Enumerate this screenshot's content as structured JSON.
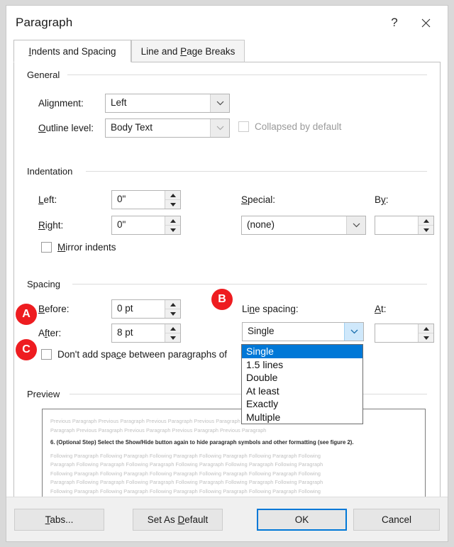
{
  "window": {
    "title": "Paragraph",
    "help_icon": "question-mark-icon",
    "close_icon": "close-icon"
  },
  "tabs": [
    {
      "label": "Indents and Spacing",
      "active": true
    },
    {
      "label": "Line and Page Breaks",
      "active": false
    }
  ],
  "general": {
    "group_label": "General",
    "alignment_label": "Alignment:",
    "alignment_value": "Left",
    "outline_label": "Outline level:",
    "outline_value": "Body Text",
    "collapsed_label": "Collapsed by default",
    "collapsed_checked": false,
    "collapsed_disabled": true
  },
  "indentation": {
    "group_label": "Indentation",
    "left_label": "Left:",
    "left_value": "0\"",
    "right_label": "Right:",
    "right_value": "0\"",
    "special_label": "Special:",
    "special_value": "(none)",
    "by_label": "By:",
    "by_value": "",
    "mirror_label": "Mirror indents",
    "mirror_checked": false
  },
  "spacing": {
    "group_label": "Spacing",
    "before_label": "Before:",
    "before_value": "0 pt",
    "after_label": "After:",
    "after_value": "8 pt",
    "dont_add_label": "Don't add space between paragraphs of",
    "dont_add_checked": false,
    "line_spacing_label": "Line spacing:",
    "line_spacing_value": "Single",
    "at_label": "At:",
    "at_value": "",
    "line_spacing_options": [
      "Single",
      "1.5 lines",
      "Double",
      "At least",
      "Exactly",
      "Multiple"
    ],
    "line_spacing_selected_index": 0
  },
  "preview": {
    "group_label": "Preview",
    "previous_lines": [
      "Previous Paragraph Previous Paragraph Previous Paragraph Previous Paragraph Previous Paragraph Previous",
      "Paragraph Previous Paragraph Previous Paragraph Previous Paragraph Previous Paragraph"
    ],
    "sample_line": "6. (Optional Step) Select the Show/Hide button again to hide paragraph symbols and other formatting (see figure 2).",
    "following_lines": [
      "Following Paragraph Following Paragraph Following Paragraph Following Paragraph Following Paragraph Following",
      "Paragraph Following Paragraph Following Paragraph Following Paragraph Following Paragraph Following Paragraph",
      "Following Paragraph Following Paragraph Following Paragraph Following Paragraph Following Paragraph Following",
      "Paragraph Following Paragraph Following Paragraph Following Paragraph Following Paragraph Following Paragraph",
      "Following Paragraph Following Paragraph Following Paragraph Following Paragraph Following Paragraph Following"
    ]
  },
  "footer": {
    "tabs_button": "Tabs...",
    "set_default_button": "Set As Default",
    "ok_button": "OK",
    "cancel_button": "Cancel"
  },
  "callouts": [
    {
      "letter": "A",
      "color": "#ee1c20"
    },
    {
      "letter": "B",
      "color": "#ee1c20"
    },
    {
      "letter": "C",
      "color": "#ee1c20"
    }
  ]
}
